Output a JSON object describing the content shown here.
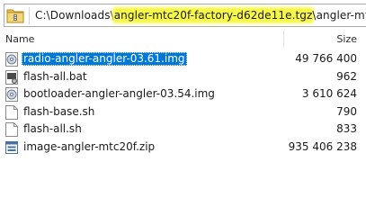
{
  "address_bar": {
    "prefix": "C:\\Downloads\\",
    "highlighted": "angler-mtc20f-factory-d62de11e.tgz",
    "suffix": "\\angler-mtc20f",
    "icon": "folder-archive-icon",
    "highlight_color": "#f7f74a"
  },
  "columns": {
    "name": "Name",
    "size": "Size"
  },
  "files": [
    {
      "name": "radio-angler-angler-03.61.img",
      "size": "49 766 400",
      "icon": "disk-image-icon",
      "selected": true
    },
    {
      "name": "flash-all.bat",
      "size": "962",
      "icon": "batch-file-icon",
      "selected": false
    },
    {
      "name": "bootloader-angler-angler-03.54.img",
      "size": "3 610 624",
      "icon": "disk-image-icon",
      "selected": false
    },
    {
      "name": "flash-base.sh",
      "size": "790",
      "icon": "text-file-icon",
      "selected": false
    },
    {
      "name": "flash-all.sh",
      "size": "833",
      "icon": "text-file-icon",
      "selected": false
    },
    {
      "name": "image-angler-mtc20f.zip",
      "size": "935 406 238",
      "icon": "zip-archive-icon",
      "selected": false
    }
  ],
  "colors": {
    "selection": "#0078d7"
  }
}
